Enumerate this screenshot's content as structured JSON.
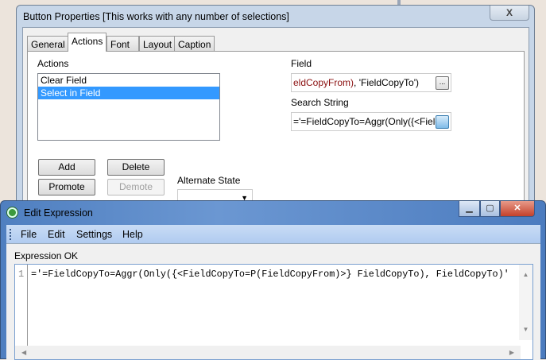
{
  "button_properties": {
    "title": "Button Properties [This works with any number of selections]",
    "close": "X",
    "tabs": [
      {
        "label": "General"
      },
      {
        "label": "Actions",
        "active": true
      },
      {
        "label": "Font"
      },
      {
        "label": "Layout"
      },
      {
        "label": "Caption"
      }
    ],
    "actions_label": "Actions",
    "actions": [
      {
        "label": "Clear Field"
      },
      {
        "label": "Select in Field",
        "selected": true
      }
    ],
    "field_label": "Field",
    "field_value_part1": "eldCopyFrom)",
    "field_value_part2": ", 'FieldCopyTo')",
    "search_label": "Search String",
    "search_value": "='=FieldCopyTo=Aggr(Only({<Field",
    "browse": "...",
    "buttons": {
      "add": "Add",
      "delete": "Delete",
      "promote": "Promote",
      "demote": "Demote"
    },
    "alt_state_label": "Alternate State",
    "alt_state_value": ""
  },
  "edit_expression": {
    "title": "Edit Expression",
    "menu": [
      "File",
      "Edit",
      "Settings",
      "Help"
    ],
    "status": "Expression OK",
    "line_number": "1",
    "code": "='=FieldCopyTo=Aggr(Only({<FieldCopyTo=P(FieldCopyFrom)>} FieldCopyTo), FieldCopyTo)'"
  }
}
